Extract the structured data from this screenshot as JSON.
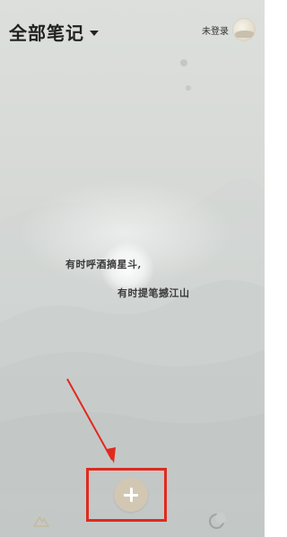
{
  "header": {
    "title": "全部笔记",
    "login_label": "未登录"
  },
  "poem": {
    "line1": "有时呼酒摘星斗,",
    "line2": "有时提笔撼江山"
  },
  "bottom_nav": {
    "left_icon": "mountain-icon",
    "center_icon": "plus-icon",
    "right_icon": "moon-icon"
  },
  "colors": {
    "annotation": "#e02a1e",
    "add_button": "#d2c7b3"
  }
}
